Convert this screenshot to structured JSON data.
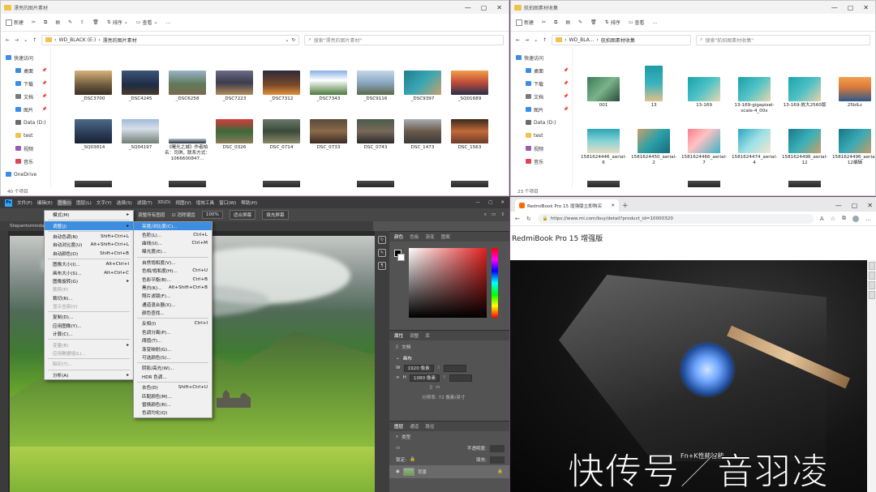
{
  "explorer_left": {
    "title": "漂亮的图片素材",
    "ribbon": [
      "新建",
      "排序",
      "查看",
      "..."
    ],
    "breadcrumb": [
      "WD_BLACK (E:)",
      "漂亮的图片素材"
    ],
    "search_placeholder": "搜索\"漂亮的图片素材\"",
    "sidebar": [
      {
        "label": "快速访问",
        "indent": false,
        "color": "#3c8ce7"
      },
      {
        "label": "桌面",
        "indent": true,
        "color": "#3c8ce7",
        "pinned": true
      },
      {
        "label": "下载",
        "indent": true,
        "color": "#3c8ce7",
        "pinned": true
      },
      {
        "label": "文档",
        "indent": true,
        "color": "#7a7a7a",
        "pinned": true
      },
      {
        "label": "图片",
        "indent": true,
        "color": "#3c8ce7",
        "pinned": true
      },
      {
        "label": "Data (D:)",
        "indent": true,
        "color": "#6a6a6a"
      },
      {
        "label": "test",
        "indent": true,
        "color": "#f0c24b"
      },
      {
        "label": "视频",
        "indent": true,
        "color": "#9b59b6"
      },
      {
        "label": "音乐",
        "indent": true,
        "color": "#e0445a"
      },
      {
        "label": "OneDrive",
        "indent": false,
        "color": "#3c8ce7"
      }
    ],
    "files": [
      {
        "name": "_DSC3700",
        "thumb": "linear-gradient(180deg,#d8b27a,#6c5a3e 60%,#3a2f22)"
      },
      {
        "name": "_DSC4245",
        "thumb": "linear-gradient(180deg,#3d5578,#1e2c44 60%,#4c3a2a)"
      },
      {
        "name": "_DSC6258",
        "thumb": "linear-gradient(180deg,#9ab3c9,#5f7a5a 55%,#7a6a4e)"
      },
      {
        "name": "_DSC7223",
        "thumb": "linear-gradient(180deg,#6e6a86,#3a3c4e 50%,#b38b5a)"
      },
      {
        "name": "_DSC7312",
        "thumb": "linear-gradient(180deg,#2d2a3a,#7a4a2a 60%,#e0903a)"
      },
      {
        "name": "_DSC7343",
        "thumb": "linear-gradient(180deg,#88aee6,#ffffff 40%,#4a7a3a)"
      },
      {
        "name": "_DSC9116",
        "thumb": "linear-gradient(180deg,#c6d8ea,#8aa7c2 50%,#5a6a4a)"
      },
      {
        "name": "_DSC9397",
        "thumb": "linear-gradient(135deg,#1e7f8c,#3aa7b3 50%,#c9a06a)"
      },
      {
        "name": "_SQ01689",
        "thumb": "linear-gradient(180deg,#f0a04a,#c8503a 45%,#2a2e4a)"
      },
      {
        "name": "_SQ03814",
        "thumb": "linear-gradient(180deg,#4d6a8a,#2a3a55 60%,#1a2233)"
      },
      {
        "name": "_SQ04197",
        "thumb": "linear-gradient(180deg,#9fbbd8,#d7dfe8 40%,#6f7e74)"
      },
      {
        "name": "《曙光之城》作者柏名：司琪，联系方式：1066600847...",
        "thumb": "linear-gradient(180deg,#b7c7d6,#5e6b78 60%,#2a2e33)",
        "short": true
      },
      {
        "name": "DSC_0326",
        "thumb": "linear-gradient(180deg,#d63a3a,#3a6a3a 50%,#8a7a5a)"
      },
      {
        "name": "DSC_0714",
        "thumb": "linear-gradient(180deg,#6a7a6a,#3a4a3a 50%,#8a8a6a)"
      },
      {
        "name": "DSC_0733",
        "thumb": "linear-gradient(180deg,#5a4a3a,#8a6a4a 50%,#3a2a22)"
      },
      {
        "name": "DSC_0743",
        "thumb": "linear-gradient(180deg,#4a5a4a,#7a6a5a 50%,#2a2a2a)"
      },
      {
        "name": "DSC_1473",
        "thumb": "linear-gradient(180deg,#a8aeb4,#6a5a4a 50%,#3a3a3a)"
      },
      {
        "name": "DSC_1563",
        "thumb": "linear-gradient(180deg,#3a2a1a,#c26a3a 50%,#6a3a2a)"
      }
    ],
    "status": "40 个项目"
  },
  "explorer_right": {
    "title": "航拍图素材收集",
    "ribbon": [
      "新建",
      "排序",
      "查看",
      "..."
    ],
    "breadcrumb": [
      "WD_BLA...",
      "航拍图素材收集"
    ],
    "search_placeholder": "搜索\"航拍图素材收集\"",
    "sidebar": [
      {
        "label": "快速访问",
        "indent": false,
        "color": "#3c8ce7"
      },
      {
        "label": "桌面",
        "indent": true,
        "color": "#3c8ce7",
        "pinned": true
      },
      {
        "label": "下载",
        "indent": true,
        "color": "#3c8ce7",
        "pinned": true
      },
      {
        "label": "文档",
        "indent": true,
        "color": "#7a7a7a",
        "pinned": true
      },
      {
        "label": "图片",
        "indent": true,
        "color": "#3c8ce7",
        "pinned": true
      },
      {
        "label": "Data (D:)",
        "indent": true,
        "color": "#6a6a6a"
      },
      {
        "label": "test",
        "indent": true,
        "color": "#f0c24b"
      },
      {
        "label": "视频",
        "indent": true,
        "color": "#9b59b6"
      },
      {
        "label": "音乐",
        "indent": true,
        "color": "#e0445a"
      }
    ],
    "files": [
      {
        "name": "001",
        "thumb": "linear-gradient(135deg,#3d7a5a,#7ab38a 50%,#2a4a3a)"
      },
      {
        "name": "13",
        "thumb": "linear-gradient(180deg,#1e9aa6,#3ab3bd 50%,#e0c08a)",
        "tall": true
      },
      {
        "name": "13-169",
        "thumb": "linear-gradient(135deg,#17a3ad,#4fc2c6 50%,#e8d8b0)"
      },
      {
        "name": "13-169-gigapixel-scale-4_00x",
        "thumb": "linear-gradient(135deg,#1aa0aa,#53c3c6 50%,#e6d6ae)"
      },
      {
        "name": "13-169-放大2560版",
        "thumb": "linear-gradient(135deg,#1ba4ad,#4ec0c4 50%,#e4d2aa)"
      },
      {
        "name": "25bILc",
        "thumb": "linear-gradient(180deg,#f0a050,#e07a3a 40%,#2a5a8a)"
      },
      {
        "name": "1581624446_aerial-6",
        "thumb": "linear-gradient(180deg,#2aa6b5,#86d3d6 50%,#e8dcc0)"
      },
      {
        "name": "1581624450_aerial-2",
        "thumb": "linear-gradient(135deg,#c9a06a,#2aa0a8 50%,#1a6a7a)"
      },
      {
        "name": "1581624466_aerial-7",
        "thumb": "linear-gradient(135deg,#ff7a8a,#ffc2c2 40%,#3ab3c6)"
      },
      {
        "name": "1581624474_aerial-4",
        "thumb": "linear-gradient(135deg,#2aa6c0,#9ee0e6 50%,#f0e8d0)"
      },
      {
        "name": "1581624496_aerial-12",
        "thumb": "linear-gradient(135deg,#1a7a8a,#3ab0b8 50%,#c9a06a)"
      },
      {
        "name": "1581624496_aerial-12编辑",
        "thumb": "linear-gradient(135deg,#167682,#3aaab6 50%,#c59c66)"
      }
    ],
    "status": "23 个项目"
  },
  "photoshop": {
    "menubar": [
      "文件(F)",
      "编辑(E)",
      "图像(I)",
      "图层(L)",
      "文字(Y)",
      "选择(S)",
      "滤镜(T)",
      "3D(D)",
      "视图(V)",
      "增效工具",
      "窗口(W)",
      "帮助(H)"
    ],
    "options": [
      "调整所有图层",
      "消除锯齿",
      "100%",
      "适合屏幕",
      "填充屏幕"
    ],
    "doc_tab": "Stepantsminda...",
    "panel_tabs_color": [
      "颜色",
      "色板",
      "渐变",
      "图案"
    ],
    "panel_tabs_props": [
      "属性",
      "调整",
      "库"
    ],
    "props": {
      "doc_label": "文档",
      "canvas_label": "画布",
      "w_label": "W",
      "w_value": "1920 像素",
      "h_label": "H",
      "h_value": "1080 像素",
      "x_label": "X",
      "y_label": "Y",
      "resolution": "分辨率: 72 像素/英寸"
    },
    "panel_tabs_layers": [
      "图层",
      "通道",
      "路径"
    ],
    "layers": {
      "filter_label": "类型",
      "opacity_label": "不透明度:",
      "lock_label": "锁定:",
      "fill_label": "填充:",
      "layer_name": "背景"
    },
    "image_menu": [
      {
        "label": "模式(M)",
        "sub": true
      },
      {
        "sep": true
      },
      {
        "label": "调整(J)",
        "sub": true,
        "hl": true
      },
      {
        "sep": true
      },
      {
        "label": "自动色调(N)",
        "sc": "Shift+Ctrl+L"
      },
      {
        "label": "自动对比度(U)",
        "sc": "Alt+Shift+Ctrl+L"
      },
      {
        "label": "自动颜色(O)",
        "sc": "Shift+Ctrl+B"
      },
      {
        "sep": true
      },
      {
        "label": "图像大小(I)...",
        "sc": "Alt+Ctrl+I"
      },
      {
        "label": "画布大小(S)...",
        "sc": "Alt+Ctrl+C"
      },
      {
        "label": "图像旋转(G)",
        "sub": true
      },
      {
        "label": "裁剪(P)",
        "dis": true
      },
      {
        "label": "裁切(R)..."
      },
      {
        "label": "显示全部(V)",
        "dis": true
      },
      {
        "sep": true
      },
      {
        "label": "复制(D)..."
      },
      {
        "label": "应用图像(Y)..."
      },
      {
        "label": "计算(C)..."
      },
      {
        "sep": true
      },
      {
        "label": "变量(B)",
        "sub": true,
        "dis": true
      },
      {
        "label": "应用数据组(L)...",
        "dis": true
      },
      {
        "sep": true
      },
      {
        "label": "陷印(T)...",
        "dis": true
      },
      {
        "sep": true
      },
      {
        "label": "分析(A)",
        "sub": true
      }
    ],
    "adjust_menu": [
      {
        "label": "亮度/对比度(C)...",
        "hl": true
      },
      {
        "label": "色阶(L)...",
        "sc": "Ctrl+L"
      },
      {
        "label": "曲线(U)...",
        "sc": "Ctrl+M"
      },
      {
        "label": "曝光度(E)..."
      },
      {
        "sep": true
      },
      {
        "label": "自然饱和度(V)..."
      },
      {
        "label": "色相/饱和度(H)...",
        "sc": "Ctrl+U"
      },
      {
        "label": "色彩平衡(B)...",
        "sc": "Ctrl+B"
      },
      {
        "label": "黑白(K)...",
        "sc": "Alt+Shift+Ctrl+B"
      },
      {
        "label": "照片滤镜(F)..."
      },
      {
        "label": "通道混合器(X)..."
      },
      {
        "label": "颜色查找..."
      },
      {
        "sep": true
      },
      {
        "label": "反相(I)",
        "sc": "Ctrl+I"
      },
      {
        "label": "色调分离(P)..."
      },
      {
        "label": "阈值(T)..."
      },
      {
        "label": "渐变映射(G)..."
      },
      {
        "label": "可选颜色(S)..."
      },
      {
        "sep": true
      },
      {
        "label": "阴影/高光(W)..."
      },
      {
        "label": "HDR 色调..."
      },
      {
        "sep": true
      },
      {
        "label": "去色(D)",
        "sc": "Shift+Ctrl+U"
      },
      {
        "label": "匹配颜色(M)..."
      },
      {
        "label": "替换颜色(R)..."
      },
      {
        "label": "色调均化(Q)"
      }
    ]
  },
  "edge": {
    "tab_title": "RedmiBook Pro 15 增强版立即购买",
    "url": "https://www.mi.com/buy/detail?product_id=10000320",
    "page_heading": "RedmiBook Pro 15 增强版",
    "caption": "Fn+K性能智能"
  },
  "watermark": "快传号／音羽凌"
}
